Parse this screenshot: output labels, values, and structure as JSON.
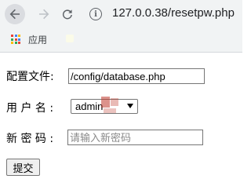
{
  "browser": {
    "url": "127.0.0.38/resetpw.php",
    "bookmarks": [
      {
        "label": "应用",
        "icon": "apps-grid-icon"
      }
    ],
    "nav_icons": [
      "back-arrow-icon",
      "forward-arrow-icon",
      "reload-icon",
      "site-info-icon"
    ]
  },
  "form": {
    "config_label": "配置文件:",
    "config_value": "/config/database.php",
    "username_label": "用 户 名 :",
    "username_selected": "admin",
    "password_label": "新 密 码 :",
    "password_placeholder": "请输入新密码",
    "submit_label": "提交"
  },
  "colors": {
    "apps_icon_colors": [
      "#ea4335",
      "#4285f4",
      "#fbbc05",
      "#34a853",
      "#ea4335",
      "#4285f4",
      "#fbbc05",
      "#34a853",
      "#ea4335"
    ]
  }
}
